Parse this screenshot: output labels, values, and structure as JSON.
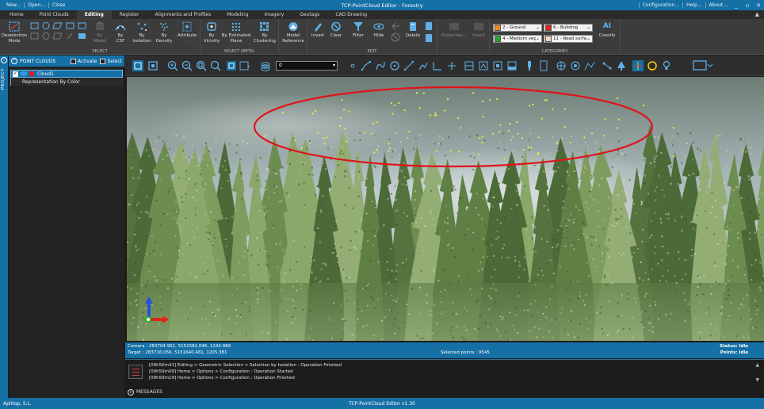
{
  "titlebar": {
    "quick": [
      "New...",
      "Open...",
      "Close"
    ],
    "title": "TCP-PointCloud Editor - Forestry",
    "right": [
      "Configuration...",
      "Help...",
      "About..."
    ],
    "window_controls": [
      "_",
      "▫",
      "✕"
    ]
  },
  "menu": {
    "tabs": [
      "Home",
      "Point Clouds",
      "Editing",
      "Register",
      "Alignments and Profiles",
      "Modeling",
      "Imagery",
      "Geotags",
      "CAD Drawing"
    ],
    "active": "Editing",
    "collapse": "▲"
  },
  "ribbon": {
    "select_group": {
      "name": "SELECT",
      "deselection_mode": [
        "Deselection",
        "Mode"
      ],
      "by_model": [
        "By",
        "Model"
      ],
      "by_csf": [
        "By",
        "CSF"
      ],
      "by_isolation": [
        "By",
        "Isolation"
      ],
      "by_density": [
        "By",
        "Density"
      ],
      "attribute": [
        "Attribute",
        "·"
      ]
    },
    "select_beta_group": {
      "name": "SELECT (BETA)",
      "by_vicinity": [
        "By",
        "Vicinity"
      ],
      "by_estimated_plane": [
        "By Estimated",
        "Plane"
      ],
      "by_clustering": [
        "By",
        "Clustering"
      ]
    },
    "model_reference": [
      "Model",
      "Reference"
    ],
    "edit_group": {
      "name": "EDIT",
      "invert": "Invert",
      "clear": "Clear",
      "filter": "Filter",
      "hide": "Hide",
      "delete": "Delete"
    },
    "properties": "Properties...",
    "invert2": "Invert",
    "categories_group": {
      "name": "CATEGORIES",
      "items": [
        {
          "label": "2 - Ground",
          "color": "#f08a1c"
        },
        {
          "label": "6 - Building",
          "color": "#e8231c"
        },
        {
          "label": "4 - Medium veç",
          "color": "#21a82b"
        },
        {
          "label": "11 - Road surfa",
          "color": "#f5d8b8"
        }
      ]
    },
    "classify": {
      "badge": "AI",
      "label": "Classify"
    }
  },
  "panel": {
    "strip_label": "PROJECT",
    "strip_btn": "‹",
    "header": "POINT CLOUDS",
    "header_btn": "^",
    "activate": "Activate",
    "select": "Select",
    "cloud_name": "Cloud1",
    "cloud_check": "✓",
    "representation": "Representation By Color"
  },
  "toolbar": {
    "layer_value": "0",
    "layer_caret": "▾"
  },
  "status": {
    "camera": "Camera : 283704.951, 5151581.046, 1234.989",
    "target": "Target : 283716.056, 5151640.481, 1205.381",
    "selected": "Selected points : 9545",
    "status_idle": "Status: Idle",
    "points_idle": "Points: Idle"
  },
  "messages": {
    "lines": [
      "[09h56m41] Editing > Geometric Selection > Selection by Isolation : Operation Finished",
      "[09h59m09] Home > Options > Configuration : Operation Started",
      "[09h59m19] Home > Options > Configuration : Operation Finished"
    ],
    "header": "MESSAGES",
    "header_btn": "v",
    "scroll_up": "▲",
    "scroll_down": "▼"
  },
  "appbar": {
    "company": "Aplitop, S.L.",
    "version": "TCP-PointCloud Editor v1.30"
  },
  "colors": {
    "accent": "#1570a6",
    "selection_ellipse": "#e0141a",
    "selected_points": "#e8f03a"
  }
}
